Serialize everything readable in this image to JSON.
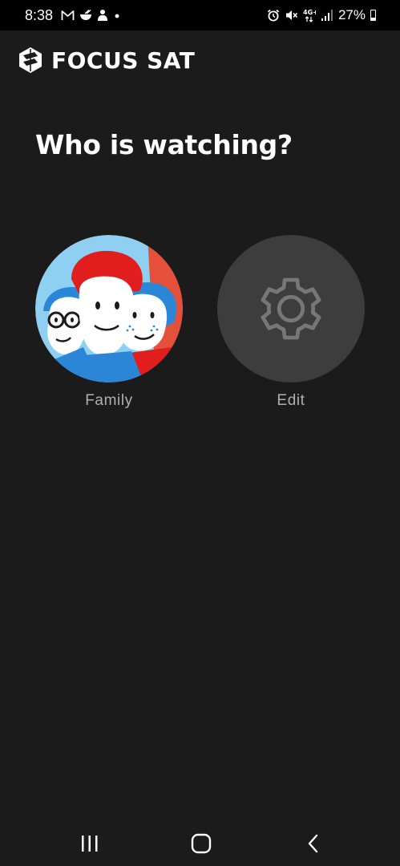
{
  "status_bar": {
    "time": "8:38",
    "battery": "27%",
    "left_icons": [
      "gmail-icon",
      "ramen-icon",
      "person-icon",
      "dot-icon"
    ],
    "right_icons": [
      "alarm-icon",
      "mute-icon",
      "4g-icon",
      "signal-icon",
      "battery-icon"
    ]
  },
  "header": {
    "brand_name": "FOCUS SAT",
    "logo_icon": "focus-sat-logo-icon"
  },
  "main": {
    "title": "Who is watching?",
    "profiles": [
      {
        "label": "Family",
        "icon": "family-avatar"
      },
      {
        "label": "Edit",
        "icon": "gear-icon"
      }
    ]
  },
  "nav": {
    "buttons": [
      "recents-icon",
      "home-icon",
      "back-icon"
    ]
  },
  "colors": {
    "background": "#1b1b1b",
    "status_bar": "#000000",
    "edit_circle": "#3d3d3d",
    "label": "#b0b0b0",
    "avatar_bg": "#e4503a",
    "avatar_blue": "#2c86d8",
    "avatar_red": "#e11d1d"
  }
}
